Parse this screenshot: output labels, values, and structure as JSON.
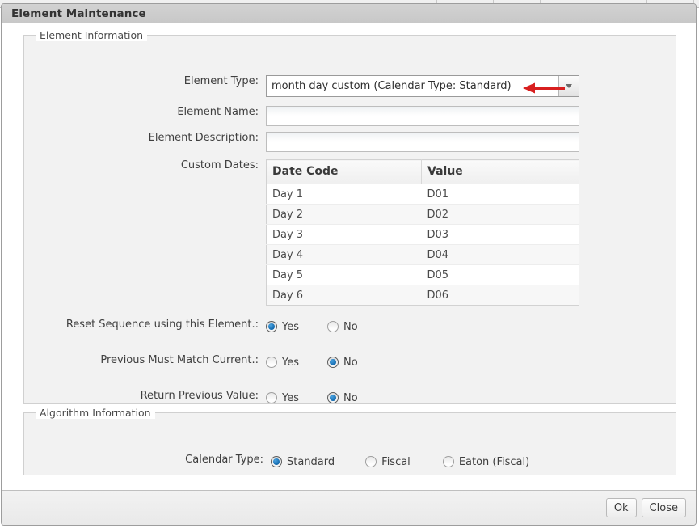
{
  "window": {
    "title": "Element Maintenance"
  },
  "element_information": {
    "legend": "Element Information",
    "element_type": {
      "label": "Element Type:",
      "value": "month day custom (Calendar Type: Standard)",
      "caret_visible": true,
      "annotation": {
        "type": "arrow",
        "direction": "left",
        "color": "#d81f1f"
      }
    },
    "element_name": {
      "label": "Element Name:",
      "value": "",
      "placeholder": ""
    },
    "element_description": {
      "label": "Element Description:",
      "value": "",
      "placeholder": ""
    },
    "custom_dates": {
      "label": "Custom Dates:",
      "columns": [
        "Date Code",
        "Value"
      ],
      "rows": [
        [
          "Day 1",
          "D01"
        ],
        [
          "Day 2",
          "D02"
        ],
        [
          "Day 3",
          "D03"
        ],
        [
          "Day 4",
          "D04"
        ],
        [
          "Day 5",
          "D05"
        ],
        [
          "Day 6",
          "D06"
        ]
      ]
    },
    "reset_sequence": {
      "label": "Reset Sequence using this Element.:",
      "options": [
        "Yes",
        "No"
      ],
      "selected": "Yes"
    },
    "previous_must_match": {
      "label": "Previous Must Match Current.:",
      "options": [
        "Yes",
        "No"
      ],
      "selected": "No"
    },
    "return_previous_value": {
      "label": "Return Previous Value:",
      "options": [
        "Yes",
        "No"
      ],
      "selected": "No"
    }
  },
  "algorithm_information": {
    "legend": "Algorithm Information",
    "calendar_type": {
      "label": "Calendar Type:",
      "options": [
        "Standard",
        "Fiscal",
        "Eaton (Fiscal)"
      ],
      "selected": "Standard"
    }
  },
  "footer": {
    "ok_label": "Ok",
    "close_label": "Close"
  },
  "theme": {
    "accent": "#1269ae",
    "annotation": "#d81f1f",
    "panel_bg": "#f2f2f2",
    "titlebar_bg": "#cccccc"
  }
}
